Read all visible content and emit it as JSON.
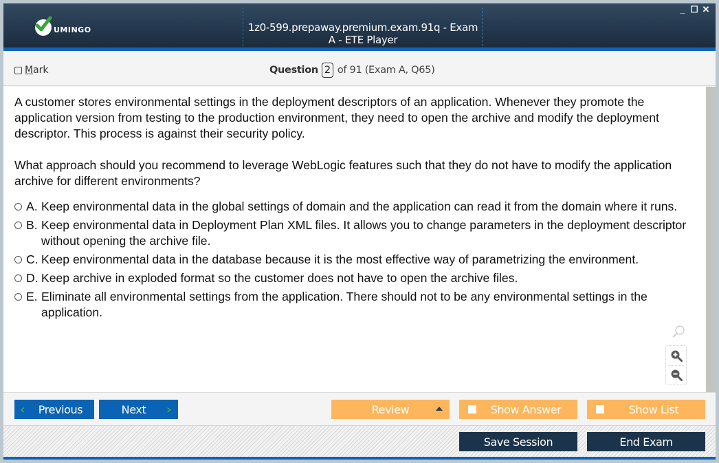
{
  "window": {
    "title": "1z0-599.prepaway.premium.exam.91q - Exam A - ETE Player",
    "logo_text": "UMINGO",
    "controls": {
      "minimize": "_",
      "maximize": "☐",
      "close": "✕"
    }
  },
  "header": {
    "mark_label_first": "M",
    "mark_label_rest": "ark",
    "question_label": "Question",
    "question_number": "2",
    "question_suffix": "of 91 (Exam A, Q65)"
  },
  "question": {
    "paragraphs": [
      "A customer stores environmental settings in the deployment descriptors of an application. Whenever they promote the application version from testing to the production environment, they need to open the archive and modify the deployment descriptor. This process is against their security policy.",
      "What approach should you recommend to leverage WebLogic features such that they do not have to modify the application archive for different environments?"
    ],
    "options": [
      {
        "letter": "A.",
        "text": "Keep environmental data in the global settings of domain and the application can read it from the domain where it runs."
      },
      {
        "letter": "B.",
        "text": "Keep environmental data in Deployment Plan XML files. It allows you to change parameters in the deployment descriptor without opening the archive file."
      },
      {
        "letter": "C.",
        "text": "Keep environmental data in the database because it is the most effective way of parametrizing the environment."
      },
      {
        "letter": "D.",
        "text": "Keep archive in exploded format so the customer does not have to open the archive files."
      },
      {
        "letter": "E.",
        "text": "Eliminate all environmental settings from the application. There should not to be any environmental settings in the application."
      }
    ]
  },
  "toolbar": {
    "previous_label": "Previous",
    "next_label": "Next",
    "review_label": "Review",
    "show_answer_label": "Show Answer",
    "show_list_label": "Show List",
    "save_session_label": "Save Session",
    "end_exam_label": "End Exam"
  },
  "colors": {
    "accent_blue": "#0a63b4",
    "orange": "#fdb65c",
    "dark_navy": "#1b344b",
    "chevron_green": "#42a842"
  }
}
